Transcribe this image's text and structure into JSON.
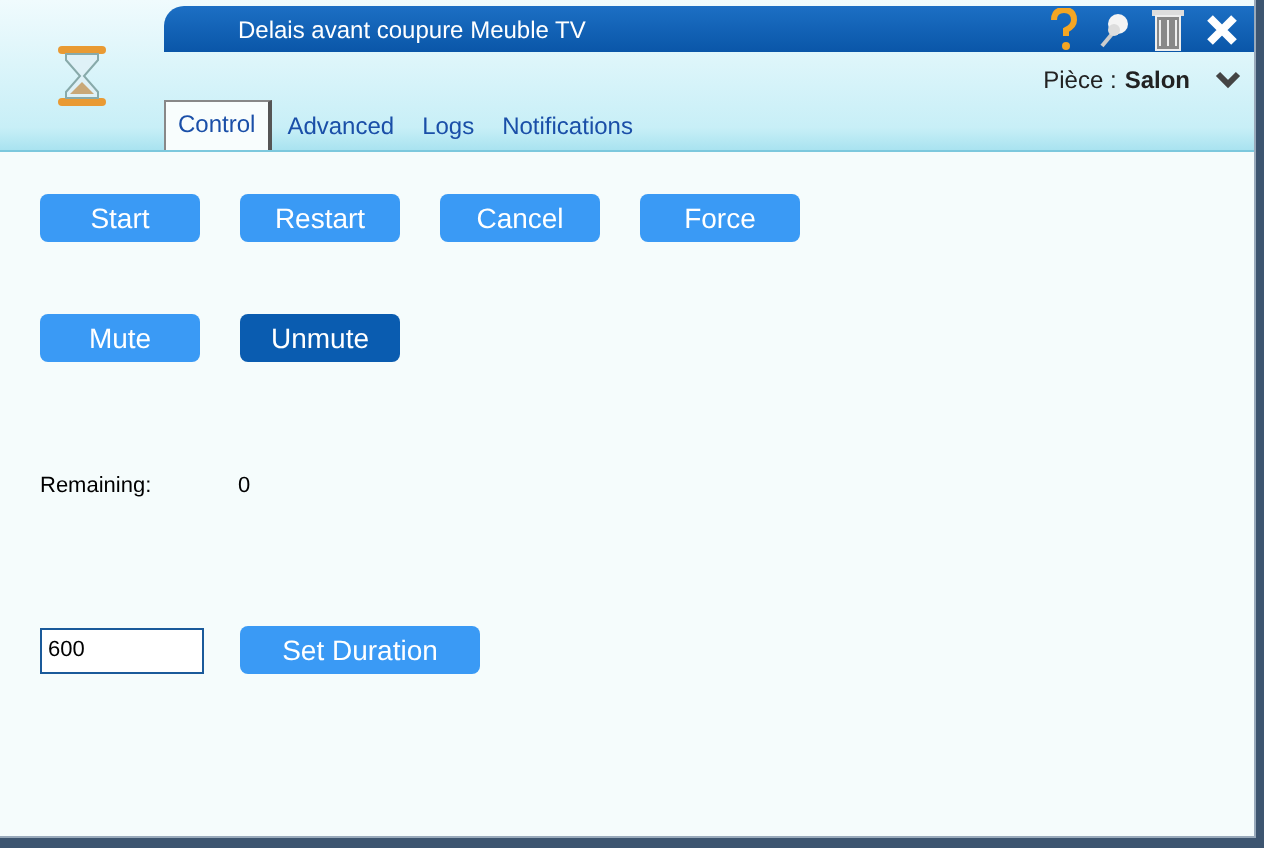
{
  "window": {
    "title": "Delais avant coupure Meuble TV"
  },
  "room": {
    "label": "Pièce :",
    "value": "Salon"
  },
  "tabs": [
    {
      "label": "Control",
      "selected": true
    },
    {
      "label": "Advanced",
      "selected": false
    },
    {
      "label": "Logs",
      "selected": false
    },
    {
      "label": "Notifications",
      "selected": false
    }
  ],
  "button_rows": [
    [
      {
        "label": "Start",
        "active": false
      },
      {
        "label": "Restart",
        "active": false
      },
      {
        "label": "Cancel",
        "active": false
      },
      {
        "label": "Force",
        "active": false
      }
    ],
    [
      {
        "label": "Mute",
        "active": false
      },
      {
        "label": "Unmute",
        "active": true
      }
    ]
  ],
  "remaining": {
    "label": "Remaining:",
    "value": "0"
  },
  "duration": {
    "value": "600",
    "button": "Set Duration"
  }
}
